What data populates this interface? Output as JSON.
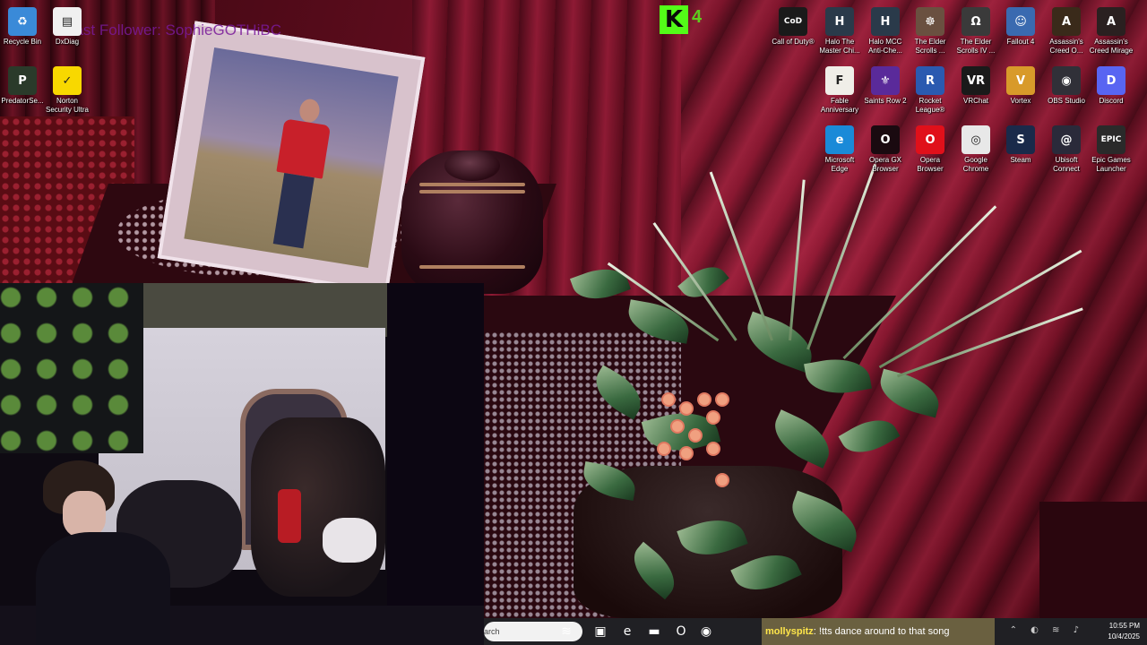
{
  "overlay": {
    "banner_text": "Last Follower: SophieGOTHiBC",
    "kick_logo": "K",
    "kick_count": "4"
  },
  "desktop_icons": [
    {
      "label": "Recycle Bin",
      "icon": "recycle-bin-icon",
      "color": "#3a8ad8",
      "glyph": "♻"
    },
    {
      "label": "DxDiag",
      "icon": "document-icon",
      "color": "#f0f0f0",
      "glyph": "▤"
    },
    {
      "label": "PredatorSe...",
      "icon": "predator-sense-icon",
      "color": "#2a3a2a",
      "glyph": "P"
    },
    {
      "label": "Norton Security Ultra",
      "icon": "norton-icon",
      "color": "#f8d800",
      "glyph": "✓"
    },
    {
      "label": "Call of Duty®",
      "icon": "call-of-duty-icon",
      "color": "#1a1a1a",
      "glyph": "CoD"
    },
    {
      "label": "Halo The Master Chi...",
      "icon": "halo-mcc-icon",
      "color": "#2a3a4a",
      "glyph": "H"
    },
    {
      "label": "Halo MCC Anti-Che...",
      "icon": "halo-anticheat-icon",
      "color": "#2a3a4a",
      "glyph": "H"
    },
    {
      "label": "The Elder Scrolls ...",
      "icon": "elder-scrolls-icon",
      "color": "#6a5040",
      "glyph": "☸"
    },
    {
      "label": "The Elder Scrolls IV ...",
      "icon": "oblivion-icon",
      "color": "#3a3a3a",
      "glyph": "Ω"
    },
    {
      "label": "Fallout 4",
      "icon": "fallout-4-icon",
      "color": "#3a6ab0",
      "glyph": "☺"
    },
    {
      "label": "Assassin's Creed O...",
      "icon": "assassins-creed-odyssey-icon",
      "color": "#3a2a1a",
      "glyph": "A"
    },
    {
      "label": "Assassin's Creed Mirage",
      "icon": "assassins-creed-mirage-icon",
      "color": "#2a2020",
      "glyph": "A"
    },
    {
      "label": "Fable Anniversary",
      "icon": "fable-icon",
      "color": "#f0eee8",
      "glyph": "F"
    },
    {
      "label": "Saints Row 2",
      "icon": "saints-row-icon",
      "color": "#5a2a9a",
      "glyph": "⚜"
    },
    {
      "label": "Rocket League®",
      "icon": "rocket-league-icon",
      "color": "#2a5ab0",
      "glyph": "R"
    },
    {
      "label": "VRChat",
      "icon": "vrchat-icon",
      "color": "#1a1a1a",
      "glyph": "VR"
    },
    {
      "label": "Vortex",
      "icon": "vortex-icon",
      "color": "#d89a2a",
      "glyph": "V"
    },
    {
      "label": "OBS Studio",
      "icon": "obs-studio-icon",
      "color": "#303038",
      "glyph": "◉"
    },
    {
      "label": "Discord",
      "icon": "discord-icon",
      "color": "#5865f2",
      "glyph": "D"
    },
    {
      "label": "Microsoft Edge",
      "icon": "edge-icon",
      "color": "#1a8ad8",
      "glyph": "e"
    },
    {
      "label": "Opera GX Browser",
      "icon": "opera-gx-icon",
      "color": "#1a0a10",
      "glyph": "O"
    },
    {
      "label": "Opera Browser",
      "icon": "opera-icon",
      "color": "#e0101a",
      "glyph": "O"
    },
    {
      "label": "Google Chrome",
      "icon": "chrome-icon",
      "color": "#e8e8e8",
      "glyph": "◎"
    },
    {
      "label": "Steam",
      "icon": "steam-icon",
      "color": "#1a2a4a",
      "glyph": "S"
    },
    {
      "label": "Ubisoft Connect",
      "icon": "ubisoft-icon",
      "color": "#2a2a3a",
      "glyph": "@"
    },
    {
      "label": "Epic Games Launcher",
      "icon": "epic-games-icon",
      "color": "#2a2a2a",
      "glyph": "EPIC"
    }
  ],
  "taskbar": {
    "search_placeholder": "arch",
    "apps": [
      {
        "name": "search-highlight-icon",
        "glyph": "≋"
      },
      {
        "name": "task-view-icon",
        "glyph": "▣"
      },
      {
        "name": "edge-taskbar-icon",
        "glyph": "e"
      },
      {
        "name": "file-explorer-icon",
        "glyph": "▬"
      },
      {
        "name": "opera-taskbar-icon",
        "glyph": "O"
      },
      {
        "name": "obs-taskbar-icon",
        "glyph": "◉"
      }
    ],
    "chat_user": "mollyspitz",
    "chat_message": ": !tts dance around to that song",
    "tray_icons": "⌃ ◐ ≋ ♪",
    "time": "10:55 PM",
    "date": "10/4/2025"
  }
}
